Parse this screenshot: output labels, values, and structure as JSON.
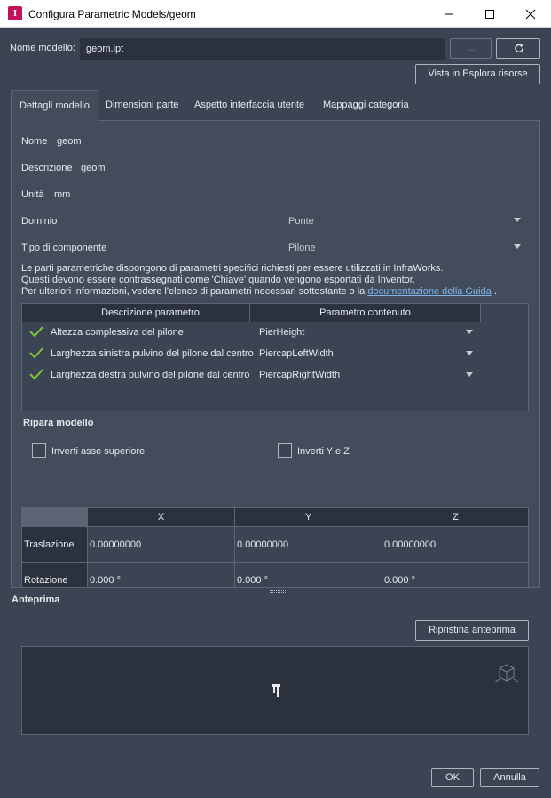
{
  "window": {
    "title": "Configura Parametric Models/geom",
    "app_icon_letter": "I",
    "minimize_icon": "minimize-icon",
    "maximize_icon": "maximize-icon",
    "close_icon": "close-icon"
  },
  "model": {
    "name_label": "Nome modello:",
    "name_value": "geom.ipt",
    "browse_label": "...",
    "refresh_icon": "refresh-icon",
    "explorer_button": "Vista in Esplora risorse"
  },
  "tabs": [
    {
      "label": "Dettagli modello",
      "active": true
    },
    {
      "label": "Dimensioni parte",
      "active": false
    },
    {
      "label": "Aspetto interfaccia utente",
      "active": false
    },
    {
      "label": "Mappaggi categoria",
      "active": false
    }
  ],
  "details": {
    "nome_label": "Nome",
    "nome_value": "geom",
    "descrizione_label": "Descrizione",
    "descrizione_value": "geom",
    "unita_label": "Unità",
    "unita_value": "mm",
    "dominio_label": "Dominio",
    "dominio_value": "Ponte",
    "tipo_label": "Tipo di componente",
    "tipo_value": "Pilone"
  },
  "info": {
    "line1": "Le parti parametriche dispongono di parametri specifici richiesti per essere utilizzati in InfraWorks.",
    "line2": "Questi devono essere contrassegnati come 'Chiave' quando vengono esportati da Inventor.",
    "line3_prefix": "Per ulteriori informazioni, vedere l'elenco di parametri necessari sottostante o la ",
    "line3_link": "documentazione della Guida",
    "line3_suffix": " ."
  },
  "param_table": {
    "headers": [
      "Descrizione parametro",
      "Parametro contenuto"
    ],
    "rows": [
      {
        "description": "Altezza complessiva del pilone",
        "parameter": "PierHeight",
        "checked": true
      },
      {
        "description": "Larghezza sinistra pulvino del pilone dal centro",
        "parameter": "PiercapLeftWidth",
        "checked": true
      },
      {
        "description": "Larghezza destra pulvino del pilone dal centro",
        "parameter": "PiercapRightWidth",
        "checked": true
      }
    ]
  },
  "repair": {
    "title": "Ripara modello",
    "invert_top_axis": "Inverti asse superiore",
    "invert_yz": "Inverti Y e Z"
  },
  "transform_table": {
    "headers": [
      "X",
      "Y",
      "Z"
    ],
    "rows": [
      {
        "label": "Traslazione",
        "values": [
          "0.00000000",
          "0.00000000",
          "0.00000000"
        ]
      },
      {
        "label": "Rotazione",
        "values": [
          "0.000 °",
          "0.000 °",
          "0.000 °"
        ]
      }
    ]
  },
  "preview": {
    "title": "Anteprima",
    "reset_button": "Ripristina anteprima",
    "viewcube_icon": "viewcube-icon",
    "model_glyph": "pier-model-icon"
  },
  "footer": {
    "ok": "OK",
    "cancel": "Annulla"
  },
  "colors": {
    "background": "#3b4453",
    "panel": "#434c5b",
    "field": "#2b323d",
    "check": "#7ec23a",
    "link": "#7fb4e8",
    "brand": "#c3125b"
  }
}
